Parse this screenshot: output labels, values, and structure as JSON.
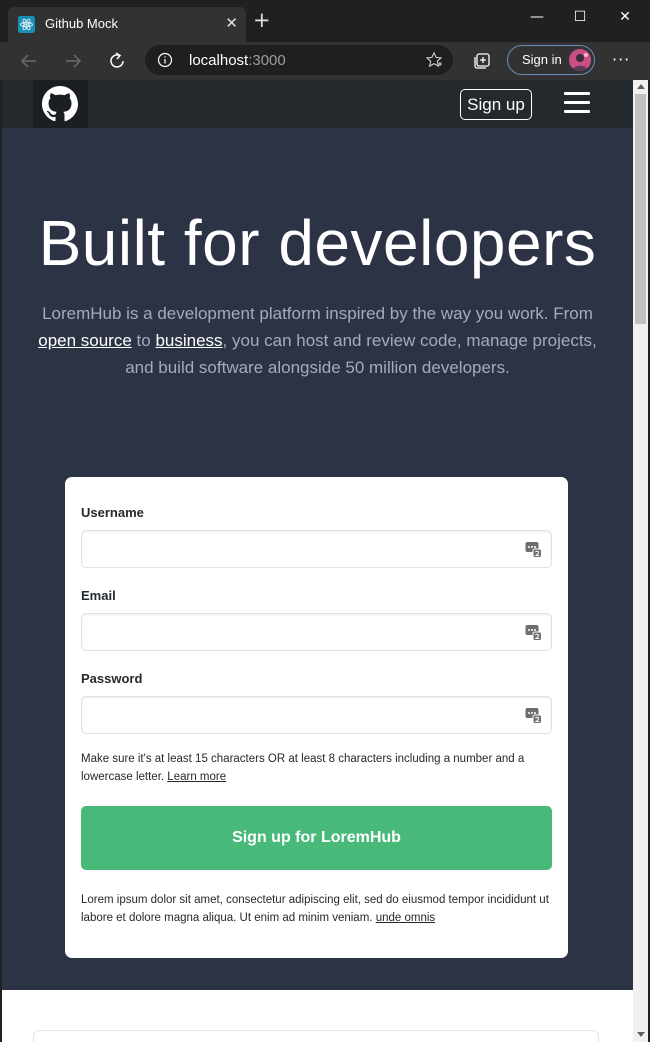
{
  "browser": {
    "tab_title": "Github Mock",
    "tab_close": "✕",
    "new_tab": "+",
    "url_host": "localhost",
    "url_port": ":3000",
    "signin_label": "Sign in",
    "more": "···",
    "minimize": "—",
    "maximize": "☐",
    "close": "✕"
  },
  "navbar": {
    "signup_label": "Sign up"
  },
  "hero": {
    "title": "Built for developers",
    "text_before": "LoremHub is a development platform inspired by the way you work. From ",
    "link_open_source": "open source",
    "text_to": " to ",
    "link_business": "business",
    "text_after": ", you can host and review code, manage projects, and build software alongside 50 million developers."
  },
  "form": {
    "username_label": "Username",
    "email_label": "Email",
    "password_label": "Password",
    "username_value": "",
    "email_value": "",
    "password_value": "",
    "hint_text": "Make sure it's at least 15 characters OR at least 8 characters including a number and a lowercase letter. ",
    "hint_link": "Learn more",
    "submit_label": "Sign up for LoremHub",
    "terms_text": "Lorem ipsum dolor sit amet, consectetur adipiscing elit, sed do eiusmod tempor incididunt ut labore et dolore magna aliqua. Ut enim ad minim veniam. ",
    "terms_link": "unde omnis"
  },
  "colors": {
    "navbar_bg": "#24292e",
    "hero_bg": "#2b3345",
    "submit_bg": "#48b978"
  }
}
